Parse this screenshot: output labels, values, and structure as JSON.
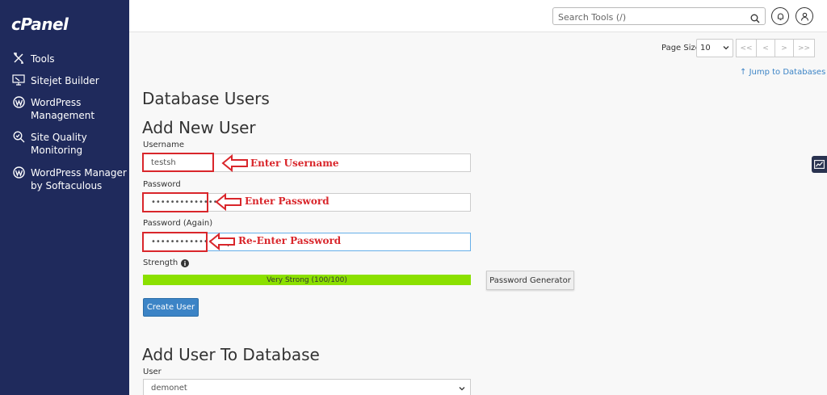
{
  "sidebar": {
    "logo": "cPanel",
    "items": [
      {
        "label": "Tools",
        "icon": "tools-icon"
      },
      {
        "label": "Sitejet Builder",
        "icon": "sitejet-icon"
      },
      {
        "label": "WordPress Management",
        "icon": "wordpress-icon"
      },
      {
        "label": "Site Quality Monitoring",
        "icon": "site-quality-icon"
      },
      {
        "label": "WordPress Manager by Softaculous",
        "icon": "wordpress-icon"
      }
    ]
  },
  "header": {
    "search_placeholder": "Search Tools (/)"
  },
  "pager": {
    "page_size_label": "Page Size",
    "page_size_value": "10",
    "first": "<<",
    "prev": "<",
    "next": ">",
    "last": ">>"
  },
  "jump_link": "Jump to Databases",
  "page_title": "Database Users",
  "add_user": {
    "heading": "Add New User",
    "username_label": "Username",
    "username_value": "testsh",
    "password_label": "Password",
    "password_value": "••••••••••••••••",
    "password_again_label": "Password (Again)",
    "password_again_value": "••••••••••••••••",
    "strength_label": "Strength",
    "strength_text": "Very Strong (100/100)",
    "strength_percent": 100,
    "password_generator_label": "Password Generator",
    "create_button_label": "Create User"
  },
  "annotations": {
    "username": "Enter Username",
    "password": "Enter Password",
    "password_again": "Re-Enter Password"
  },
  "add_to_db": {
    "heading": "Add User To Database",
    "user_label": "User",
    "user_value": "demonet"
  },
  "colors": {
    "sidebar_bg": "#1f2a5c",
    "accent": "#3c84c6",
    "annotation": "#d9262b",
    "strength_bar": "#8be000"
  }
}
